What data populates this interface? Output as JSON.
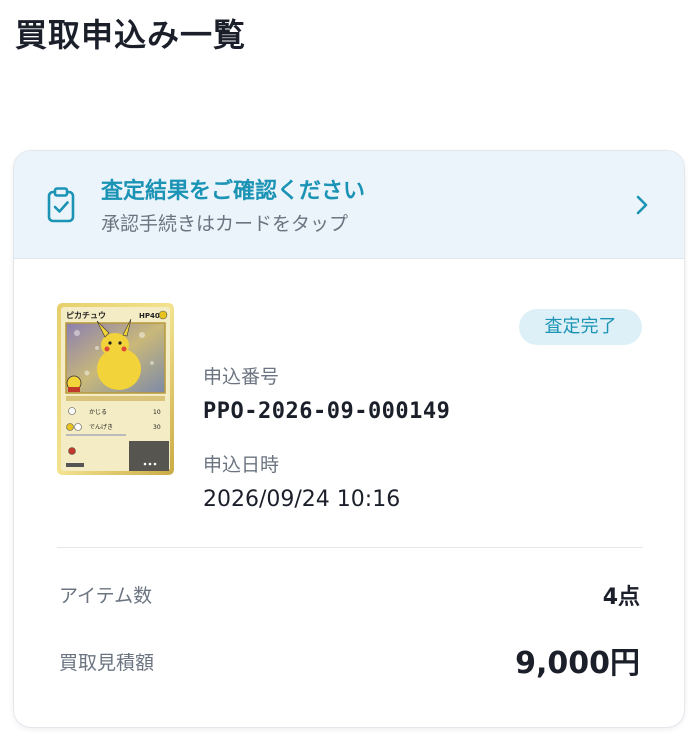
{
  "page": {
    "title": "買取申込み一覧"
  },
  "banner": {
    "title": "査定結果をご確認ください",
    "subtitle": "承認手続きはカードをタップ",
    "icon": "clipboard-check-icon",
    "chevron_icon": "chevron-right-icon"
  },
  "application": {
    "status": "査定完了",
    "number_label": "申込番号",
    "number": "PPO-2026-09-000149",
    "date_label": "申込日時",
    "date": "2026/09/24 10:16",
    "thumbnail": {
      "card_name": "ピカチュウ",
      "hp": "HP40",
      "moves": [
        {
          "name": "かじる",
          "damage": "10"
        },
        {
          "name": "でんげき",
          "damage": "30"
        }
      ]
    }
  },
  "summary": {
    "items_label": "アイテム数",
    "items_value": "4点",
    "estimate_label": "買取見積額",
    "estimate_value": "9,000円"
  },
  "colors": {
    "accent": "#1b93b5",
    "banner_bg": "#eaf4fa",
    "badge_bg": "#ddf0f7",
    "text": "#1b1f2a",
    "muted": "#6b7480"
  }
}
